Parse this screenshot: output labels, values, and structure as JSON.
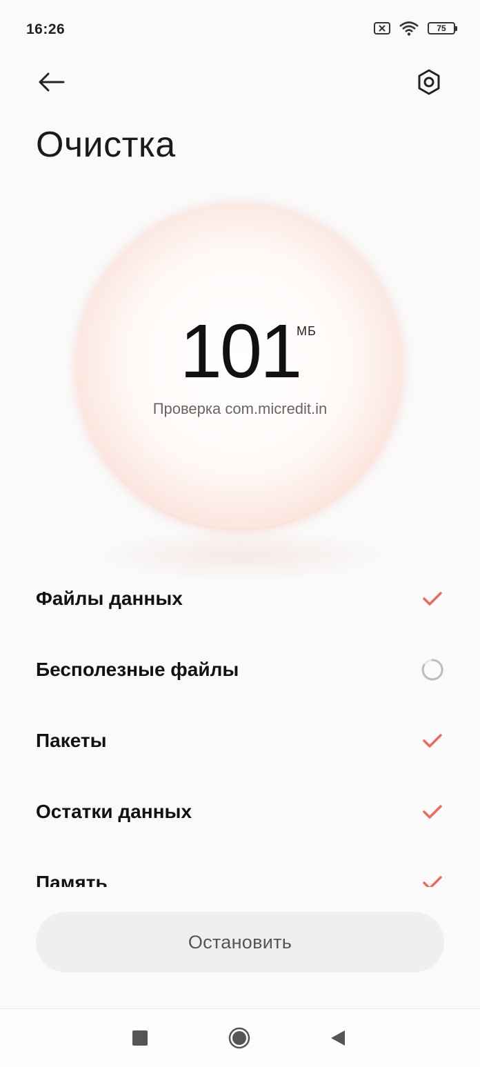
{
  "status_bar": {
    "time": "16:26",
    "battery": "75"
  },
  "header": {
    "title": "Очистка"
  },
  "scan": {
    "value": "101",
    "unit": "МБ",
    "status_text": "Проверка com.micredit.in"
  },
  "items": [
    {
      "label": "Файлы данных",
      "state": "done"
    },
    {
      "label": "Бесполезные файлы",
      "state": "loading"
    },
    {
      "label": "Пакеты",
      "state": "done"
    },
    {
      "label": "Остатки данных",
      "state": "done"
    },
    {
      "label": "Память",
      "state": "done"
    }
  ],
  "stop_button": {
    "label": "Остановить"
  },
  "colors": {
    "accent": "#ee6a55",
    "orb_edge": "#f4a895",
    "button_bg": "#efefef"
  }
}
